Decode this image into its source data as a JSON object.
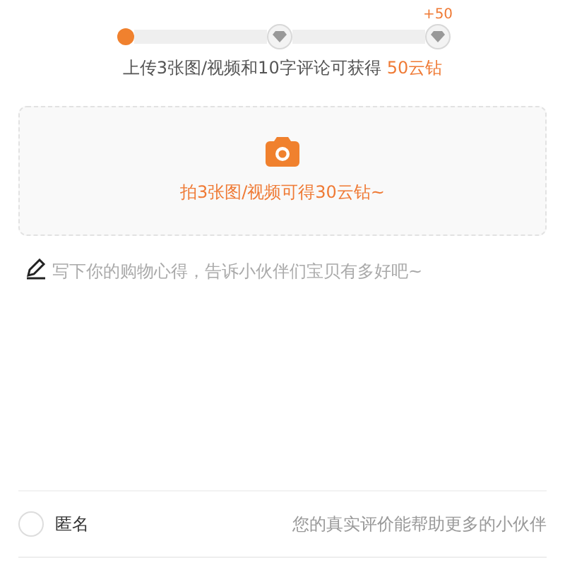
{
  "progress": {
    "milestones": [
      {
        "reached": true
      },
      {
        "reached": false
      },
      {
        "reached": false,
        "reward": "+50"
      }
    ]
  },
  "hint": {
    "text": "上传3张图/视频和10字评论可获得",
    "reward": "50云钻"
  },
  "upload": {
    "label": "拍3张图/视频可得30云钻~"
  },
  "review": {
    "placeholder": "写下你的购物心得，告诉小伙伴们宝贝有多好吧~"
  },
  "anonymous": {
    "label": "匿名",
    "checked": false,
    "note": "您的真实评价能帮助更多的小伙伴"
  }
}
